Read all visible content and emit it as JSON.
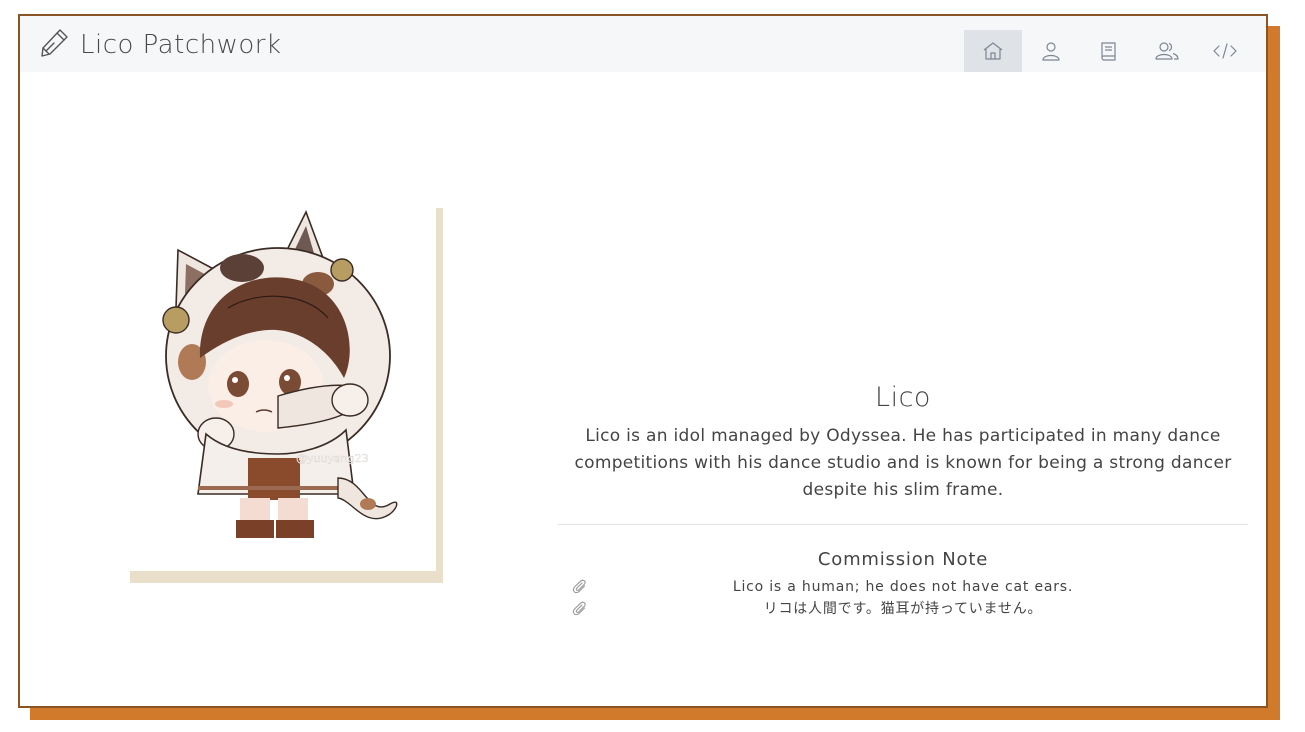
{
  "header": {
    "brand_title": "Lico Patchwork",
    "brand_icon": "pencil-icon",
    "nav": [
      {
        "icon": "home-icon",
        "active": true
      },
      {
        "icon": "user-icon",
        "active": false
      },
      {
        "icon": "book-icon",
        "active": false
      },
      {
        "icon": "users-icon",
        "active": false
      },
      {
        "icon": "code-icon",
        "active": false
      }
    ]
  },
  "character": {
    "name": "Lico",
    "description": "Lico is an idol managed by Odyssea. He has participated in many dance competitions with his dance studio and is known for being a strong dancer despite his slim frame.",
    "image_watermark": "@yuuyang23"
  },
  "commission": {
    "title": "Commission Note",
    "notes": [
      {
        "icon": "paperclip-icon",
        "text": "Lico is a human; he does not have cat ears."
      },
      {
        "icon": "paperclip-icon",
        "text": "リコは人間です。猫耳が持っていません。"
      }
    ]
  },
  "colors": {
    "frame_shadow": "#d27a2c",
    "frame_border": "#8a5424",
    "topbar": "#f6f7f9",
    "nav_active": "#dfe3e8",
    "art_shadow": "#eadfcb"
  }
}
